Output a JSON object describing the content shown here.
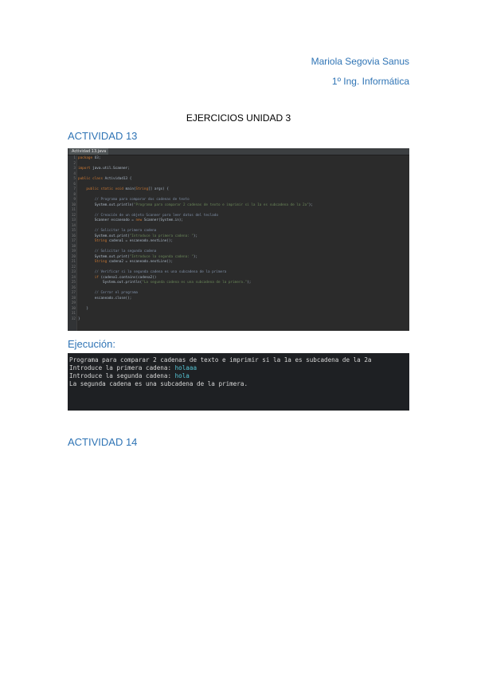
{
  "header": {
    "author": "Mariola Segovia Sanus",
    "degree": "1º Ing. Informática"
  },
  "title": "EJERCICIOS UNIDAD 3",
  "section1": {
    "heading": "ACTIVIDAD 13"
  },
  "editor": {
    "tab_label": "Actividad 13.java",
    "lines": [
      {
        "n": "1",
        "code": "package U3;"
      },
      {
        "n": "2",
        "code": ""
      },
      {
        "n": "3",
        "code": "import java.util.Scanner;"
      },
      {
        "n": "4",
        "code": ""
      },
      {
        "n": "5",
        "code": "public class Actividad13 {"
      },
      {
        "n": "6",
        "code": ""
      },
      {
        "n": "7",
        "code": "    public static void main(String[] args) {"
      },
      {
        "n": "8",
        "code": ""
      },
      {
        "n": "9",
        "code": "        // Programa para comparar dos cadenas de texto"
      },
      {
        "n": "10",
        "code": "        System.out.println(\"Programa para comparar 2 cadenas de texto e imprimir si la 1a es subcadena de la 2a\");"
      },
      {
        "n": "11",
        "code": ""
      },
      {
        "n": "12",
        "code": "        // Creación de un objeto Scanner para leer datos del teclado"
      },
      {
        "n": "13",
        "code": "        Scanner escaneado = new Scanner(System.in);"
      },
      {
        "n": "14",
        "code": ""
      },
      {
        "n": "15",
        "code": "        // Solicitar la primera cadena"
      },
      {
        "n": "16",
        "code": "        System.out.print(\"Introduce la primera cadena: \");"
      },
      {
        "n": "17",
        "code": "        String cadena1 = escaneado.nextLine();"
      },
      {
        "n": "18",
        "code": ""
      },
      {
        "n": "19",
        "code": "        // Solicitar la segunda cadena"
      },
      {
        "n": "20",
        "code": "        System.out.print(\"Introduce la segunda cadena: \");"
      },
      {
        "n": "21",
        "code": "        String cadena2 = escaneado.nextLine();"
      },
      {
        "n": "22",
        "code": ""
      },
      {
        "n": "23",
        "code": "        // Verificar si la segunda cadena es una subcadena de la primera"
      },
      {
        "n": "24",
        "code": "        if (cadena1.contains(cadena2))"
      },
      {
        "n": "25",
        "code": "            System.out.println(\"La segunda cadena es una subcadena de la primera.\");"
      },
      {
        "n": "26",
        "code": ""
      },
      {
        "n": "27",
        "code": "        // Cerrar el programa"
      },
      {
        "n": "28",
        "code": "        escaneado.close();"
      },
      {
        "n": "29",
        "code": ""
      },
      {
        "n": "30",
        "code": "    }"
      },
      {
        "n": "31",
        "code": ""
      },
      {
        "n": "32",
        "code": "}"
      }
    ]
  },
  "section2": {
    "heading": "Ejecución:"
  },
  "console": {
    "line1": "Programa para comparar 2 cadenas de texto e imprimir si la 1a es subcadena de la 2a",
    "line2_prompt": "Introduce la primera cadena: ",
    "line2_input": "holaaa",
    "line3_prompt": "Introduce la segunda cadena: ",
    "line3_input": "hola",
    "line4": "La segunda cadena es una subcadena de la primera."
  },
  "section3": {
    "heading": "ACTIVIDAD 14"
  },
  "colors": {
    "heading_blue": "#2f74b5",
    "editor_bg": "#2b2b2b",
    "console_bg": "#1e2023",
    "console_input": "#56c6d6"
  }
}
